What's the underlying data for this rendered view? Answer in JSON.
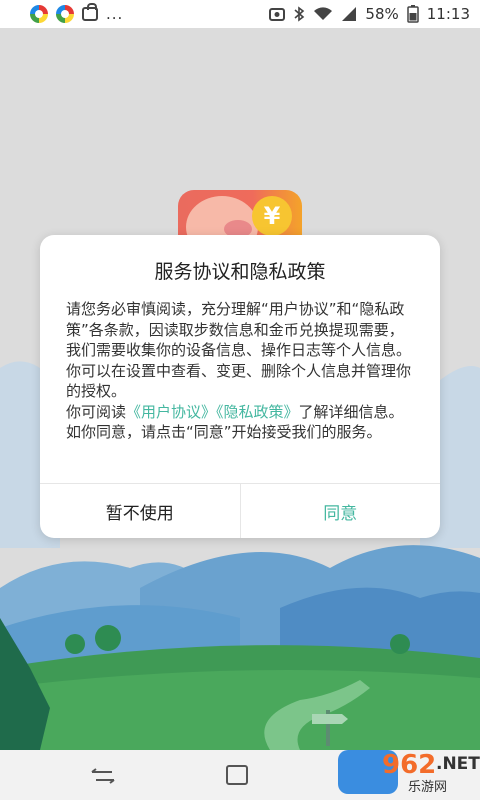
{
  "status_bar": {
    "battery": "58%",
    "time": "11:13",
    "dots": "..."
  },
  "dialog": {
    "title": "服务协议和隐私政策",
    "paragraph1": "请您务必审慎阅读，充分理解“用户协议”和“隐私政策”各条款，因读取步数信息和金币兑换提现需要，我们需要收集你的设备信息、操作日志等个人信息。你可以在设置中查看、变更、删除个人信息并管理你的授权。",
    "p2_prefix": "你可阅读",
    "link_user_agreement": "《用户协议》",
    "link_privacy_policy": "《隐私政策》",
    "p2_suffix": "了解详细信息。如你同意，请点击“同意”开始接受我们的服务。",
    "cancel_label": "暂不使用",
    "agree_label": "同意"
  },
  "app_icon": {
    "coin_symbol": "¥"
  },
  "watermark": {
    "number": "962",
    "net": ".NET",
    "text": "乐游网"
  },
  "colors": {
    "accent": "#44b7a0",
    "sky": "#dcdcdc",
    "grass": "#3f9a55"
  }
}
